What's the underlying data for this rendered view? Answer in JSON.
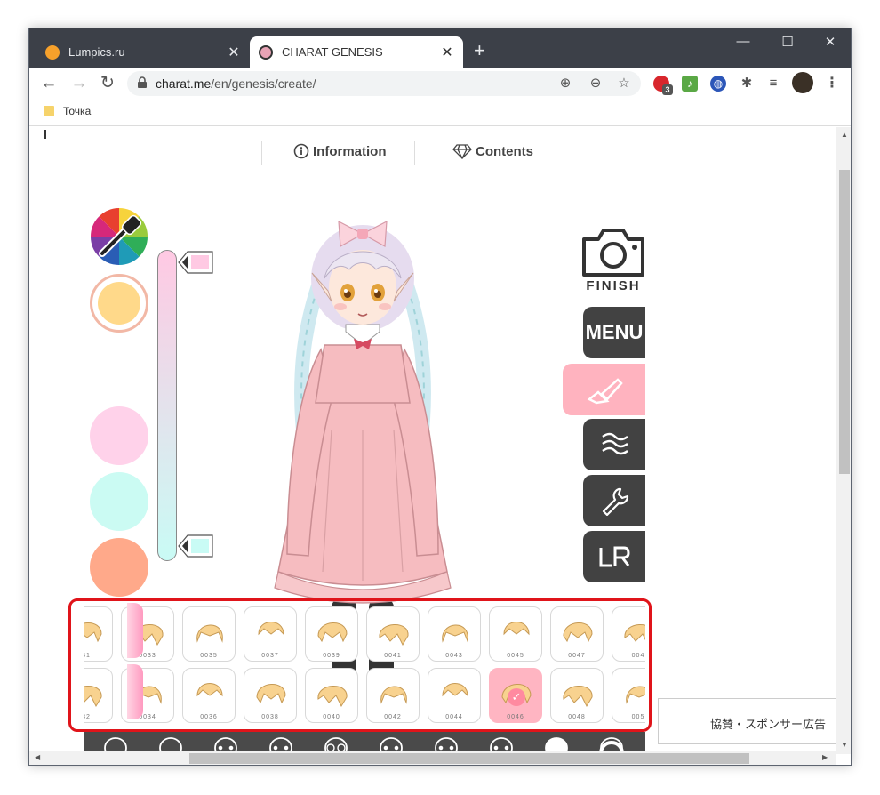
{
  "browser": {
    "tabs": [
      {
        "title": "Lumpics.ru",
        "active": false,
        "favicon_color": "#f7a12b"
      },
      {
        "title": "CHARAT GENESIS",
        "active": true,
        "favicon_color": "#e8a3b5"
      }
    ],
    "new_tab": "+",
    "window_controls": {
      "minimize": "—",
      "maximize": "☐",
      "close": "✕"
    },
    "url_host": "charat.me",
    "url_path": "/en/genesis/create/",
    "extension_badge": "3",
    "bookmark": "Точка"
  },
  "page": {
    "nav": {
      "information": "Information",
      "contents": "Contents"
    },
    "finish_label": "FINISH",
    "menu_label": "MENU",
    "swatch_colors": {
      "selected": "#ffd98a",
      "pink": "#ffd2ea",
      "mint": "#cbfbf3",
      "salmon": "#ffa98a"
    },
    "gradient_top": "#ffc9e3",
    "gradient_bottom": "#c9fbf5",
    "hair_row1": [
      "31",
      "0033",
      "0035",
      "0037",
      "0039",
      "0041",
      "0043",
      "0045",
      "0047",
      "004"
    ],
    "hair_row2": [
      "32",
      "0034",
      "0036",
      "0038",
      "0040",
      "0042",
      "0044",
      "0046",
      "0048",
      "005"
    ],
    "selected_hair": "0046",
    "hair_color": "#f8d28f",
    "ad_text": "協賛・スポンサー広告"
  }
}
